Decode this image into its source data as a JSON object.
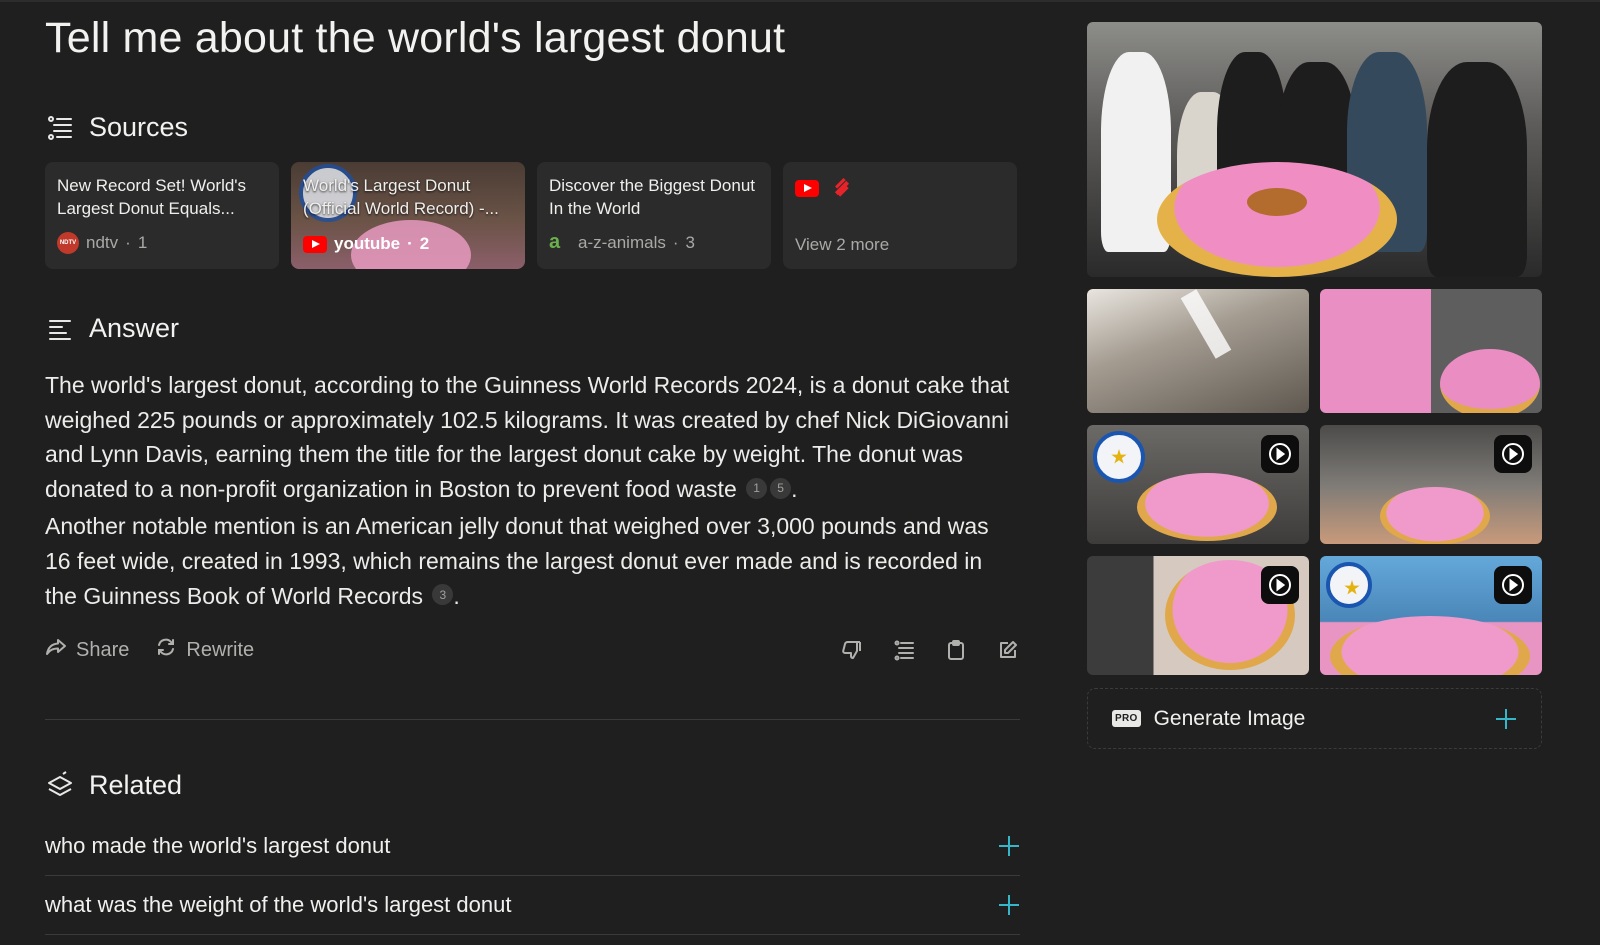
{
  "query": "Tell me about the world's largest donut",
  "sources": {
    "heading": "Sources",
    "cards": [
      {
        "title": "New Record Set! World's Largest Donut Equals...",
        "site": "ndtv",
        "index": "1"
      },
      {
        "title": "World's Largest Donut (Official World Record) -...",
        "site": "youtube",
        "index": "2"
      },
      {
        "title": "Discover the Biggest Donut In the World",
        "site": "a-z-animals",
        "index": "3"
      }
    ],
    "view_more": "View 2 more"
  },
  "answer": {
    "heading": "Answer",
    "p1": "The world's largest donut, according to the Guinness World Records 2024, is a donut cake that weighed 225 pounds or approximately 102.5 kilograms. It was created by chef Nick DiGiovanni and Lynn Davis, earning them the title for the largest donut cake by weight. The donut was donated to a non-profit organization in Boston to prevent food waste",
    "cite_1": "1",
    "cite_2": "5",
    "p2": "Another notable mention is an American jelly donut that weighed over 3,000 pounds and was 16 feet wide, created in 1993, which remains the largest donut ever made and is recorded in the Guinness Book of World Records",
    "cite_3": "3"
  },
  "actions": {
    "share": "Share",
    "rewrite": "Rewrite"
  },
  "related": {
    "heading": "Related",
    "items": [
      "who made the world's largest donut",
      "what was the weight of the world's largest donut"
    ]
  },
  "sidebar": {
    "generate_label": "Generate Image",
    "pro_badge": "PRO"
  },
  "colors": {
    "background": "#1f1f1f",
    "card": "#2b2b2b",
    "accent": "#35b6c9",
    "text": "#ececea",
    "muted": "#a9a9a6"
  }
}
